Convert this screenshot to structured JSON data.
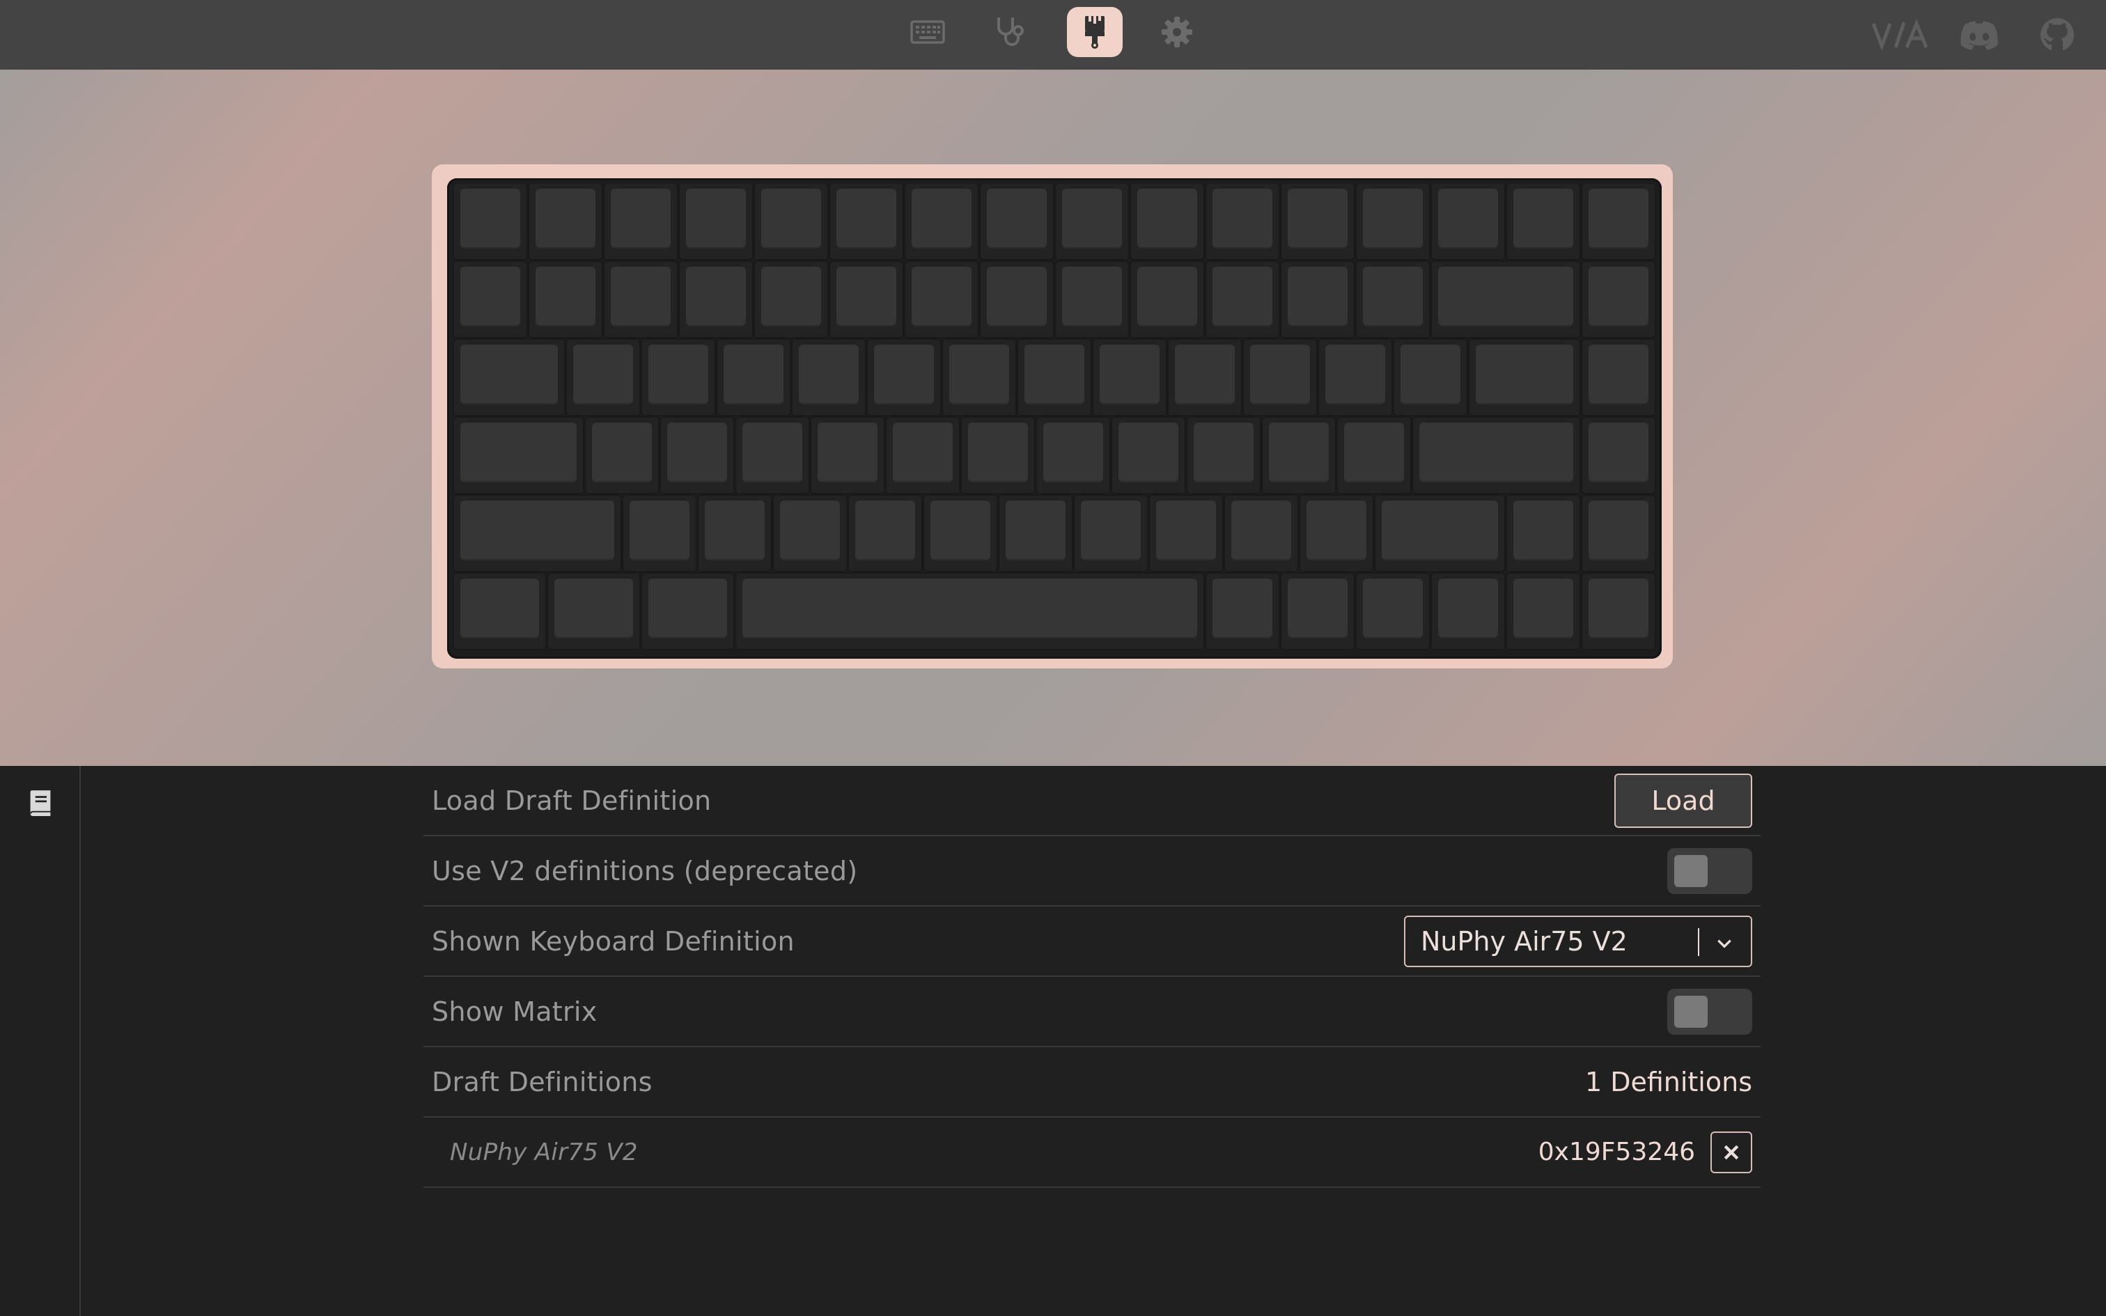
{
  "topbar": {
    "nav": [
      {
        "name": "keyboard-icon",
        "active": false
      },
      {
        "name": "stethoscope-icon",
        "active": false
      },
      {
        "name": "paintbrush-icon",
        "active": true
      },
      {
        "name": "gear-icon",
        "active": false
      }
    ],
    "external": [
      "via-logo",
      "discord-icon",
      "github-icon"
    ]
  },
  "keyboard": {
    "model": "NuPhy Air75 V2",
    "plate_color": "#efccc1",
    "keycap_color": "#363636"
  },
  "sidebar": {
    "tabs": [
      {
        "icon": "book-icon",
        "active": true
      }
    ]
  },
  "settings": {
    "load_draft_label": "Load Draft Definition",
    "load_button": "Load",
    "v2_label": "Use V2 definitions (deprecated)",
    "v2_enabled": false,
    "shown_def_label": "Shown Keyboard Definition",
    "shown_def_value": "NuPhy Air75 V2",
    "show_matrix_label": "Show Matrix",
    "show_matrix_enabled": false,
    "draft_defs_label": "Draft Definitions",
    "draft_defs_count": "1 Definitions",
    "drafts": [
      {
        "name": "NuPhy Air75 V2",
        "id": "0x19F53246"
      }
    ]
  },
  "colors": {
    "accent": "#f2d3c9",
    "topbar": "#444444",
    "background": "#202020"
  }
}
